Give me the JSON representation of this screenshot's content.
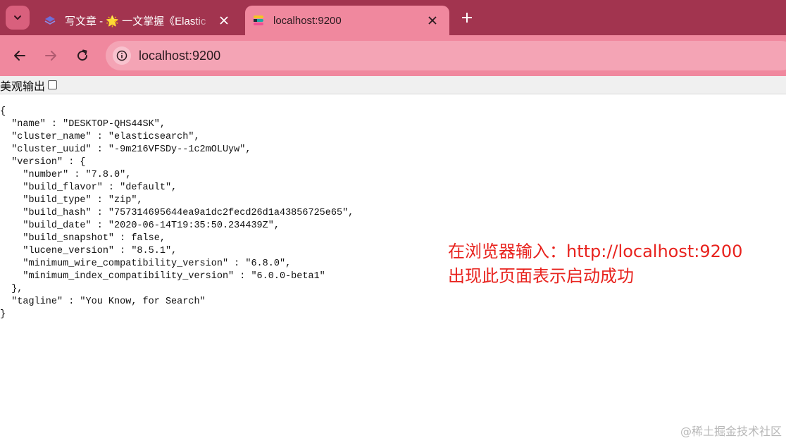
{
  "browser": {
    "tabs": [
      {
        "title": "写文章 - 🌟 一文掌握《Elastic",
        "active": false
      },
      {
        "title": "localhost:9200",
        "active": true
      }
    ],
    "address": "localhost:9200",
    "icons": {
      "tab_search": "chevron-down-icon",
      "new_tab": "plus-icon",
      "back": "arrow-left-icon",
      "forward": "arrow-right-icon",
      "reload": "reload-icon",
      "site_info": "info-icon"
    },
    "colors": {
      "tabstrip": "#a2344f",
      "toolbar": "#f0889e",
      "omnibox": "#f4a4b5"
    }
  },
  "viewer": {
    "pretty_print_label": "美观输出",
    "pretty_print_checked": false
  },
  "json_lines": [
    "{",
    "  \"name\" : \"DESKTOP-QHS44SK\",",
    "  \"cluster_name\" : \"elasticsearch\",",
    "  \"cluster_uuid\" : \"-9m216VFSDy--1c2mOLUyw\",",
    "  \"version\" : {",
    "    \"number\" : \"7.8.0\",",
    "    \"build_flavor\" : \"default\",",
    "    \"build_type\" : \"zip\",",
    "    \"build_hash\" : \"757314695644ea9a1dc2fecd26d1a43856725e65\",",
    "    \"build_date\" : \"2020-06-14T19:35:50.234439Z\",",
    "    \"build_snapshot\" : false,",
    "    \"lucene_version\" : \"8.5.1\",",
    "    \"minimum_wire_compatibility_version\" : \"6.8.0\",",
    "    \"minimum_index_compatibility_version\" : \"6.0.0-beta1\"",
    "  },",
    "  \"tagline\" : \"You Know, for Search\"",
    "}"
  ],
  "annotation": {
    "line1": "在浏览器输入：http://localhost:9200",
    "line2": "出现此页面表示启动成功",
    "color": "#e8231e"
  },
  "watermark": "@稀土掘金技术社区"
}
